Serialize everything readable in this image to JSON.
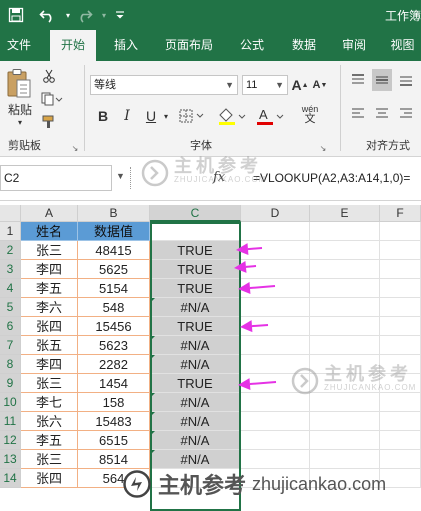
{
  "titlebar": {
    "title": "工作簿",
    "icons": [
      "save-icon",
      "undo-icon",
      "redo-icon",
      "customize-icon"
    ]
  },
  "tabs": [
    {
      "label": "文件",
      "active": false
    },
    {
      "label": "开始",
      "active": true
    },
    {
      "label": "插入",
      "active": false
    },
    {
      "label": "页面布局",
      "active": false
    },
    {
      "label": "公式",
      "active": false
    },
    {
      "label": "数据",
      "active": false
    },
    {
      "label": "审阅",
      "active": false
    },
    {
      "label": "视图",
      "active": false
    }
  ],
  "ribbon": {
    "paste_label": "粘贴",
    "clipboard_label": "剪贴板",
    "font_name": "等线",
    "font_size": "11",
    "font_group_label": "字体",
    "align_group_label": "对齐方式",
    "bold": "B",
    "italic": "I",
    "underline": "U",
    "grow_font": "A",
    "shrink_font": "A",
    "font_color_glyph": "A",
    "phonetic": "wén"
  },
  "formula_bar": {
    "name_box": "C2",
    "fx": "fx",
    "formula": "=VLOOKUP(A2,A3:A14,1,0)="
  },
  "grid": {
    "columns": [
      "A",
      "B",
      "C",
      "D",
      "E",
      "F"
    ],
    "rows": [
      "1",
      "2",
      "3",
      "4",
      "5",
      "6",
      "7",
      "8",
      "9",
      "10",
      "11",
      "12",
      "13",
      "14"
    ],
    "header_row": [
      "姓名",
      "数据值",
      ""
    ],
    "data": [
      [
        "张三",
        "48415",
        "TRUE"
      ],
      [
        "李四",
        "5625",
        "TRUE"
      ],
      [
        "李五",
        "5154",
        "TRUE"
      ],
      [
        "李六",
        "548",
        "#N/A"
      ],
      [
        "张四",
        "15456",
        "TRUE"
      ],
      [
        "张五",
        "5623",
        "#N/A"
      ],
      [
        "李四",
        "2282",
        "#N/A"
      ],
      [
        "张三",
        "1454",
        "TRUE"
      ],
      [
        "李七",
        "158",
        "#N/A"
      ],
      [
        "张六",
        "15483",
        "#N/A"
      ],
      [
        "李五",
        "6515",
        "#N/A"
      ],
      [
        "张三",
        "8514",
        "#N/A"
      ],
      [
        "张四",
        "564",
        ""
      ]
    ]
  },
  "watermark": {
    "brand": "主机参考",
    "sub": "ZHUJICANKAO.COM",
    "url": "zhujicankao.com"
  },
  "colors": {
    "excel_green": "#217346",
    "header_blue": "#5b9bd5",
    "selection_grey": "#d0d0d0",
    "arrow_magenta": "#e532e5"
  }
}
